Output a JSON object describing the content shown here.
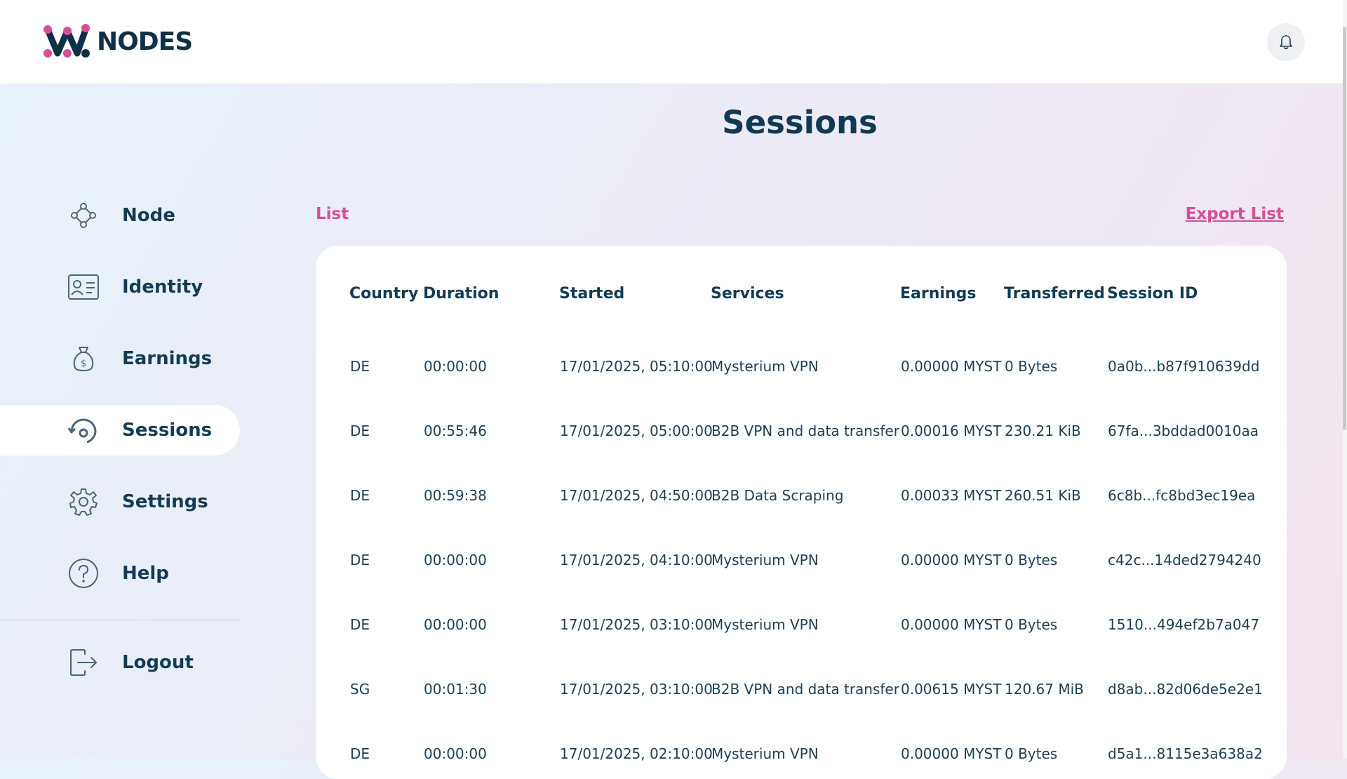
{
  "brand": {
    "name": "NODES"
  },
  "header": {
    "notification_icon": "bell-icon"
  },
  "page": {
    "title": "Sessions"
  },
  "sidebar": {
    "items": [
      {
        "label": "Node",
        "icon": "node-icon",
        "active": false
      },
      {
        "label": "Identity",
        "icon": "id-card-icon",
        "active": false
      },
      {
        "label": "Earnings",
        "icon": "money-bag-icon",
        "active": false
      },
      {
        "label": "Sessions",
        "icon": "sessions-icon",
        "active": true
      },
      {
        "label": "Settings",
        "icon": "gear-icon",
        "active": false
      },
      {
        "label": "Help",
        "icon": "help-icon",
        "active": false
      }
    ],
    "logout": {
      "label": "Logout",
      "icon": "logout-icon"
    }
  },
  "toolbar": {
    "list_label": "List",
    "export_label": "Export List"
  },
  "table": {
    "columns": [
      "Country",
      "Duration",
      "Started",
      "Services",
      "Earnings",
      "Transferred",
      "Session ID"
    ],
    "rows": [
      [
        "DE",
        "00:00:00",
        "17/01/2025, 05:10:00",
        "Mysterium VPN",
        "0.00000 MYST",
        "0 Bytes",
        "0a0b...b87f910639dd"
      ],
      [
        "DE",
        "00:55:46",
        "17/01/2025, 05:00:00",
        "B2B VPN and data transfer",
        "0.00016 MYST",
        "230.21 KiB",
        "67fa...3bddad0010aa"
      ],
      [
        "DE",
        "00:59:38",
        "17/01/2025, 04:50:00",
        "B2B Data Scraping",
        "0.00033 MYST",
        "260.51 KiB",
        "6c8b...fc8bd3ec19ea"
      ],
      [
        "DE",
        "00:00:00",
        "17/01/2025, 04:10:00",
        "Mysterium VPN",
        "0.00000 MYST",
        "0 Bytes",
        "c42c...14ded2794240"
      ],
      [
        "DE",
        "00:00:00",
        "17/01/2025, 03:10:00",
        "Mysterium VPN",
        "0.00000 MYST",
        "0 Bytes",
        "1510...494ef2b7a047"
      ],
      [
        "SG",
        "00:01:30",
        "17/01/2025, 03:10:00",
        "B2B VPN and data transfer",
        "0.00615 MYST",
        "120.67 MiB",
        "d8ab...82d06de5e2e1"
      ],
      [
        "DE",
        "00:00:00",
        "17/01/2025, 02:10:00",
        "Mysterium VPN",
        "0.00000 MYST",
        "0 Bytes",
        "d5a1...8115e3a638a2"
      ]
    ]
  },
  "colors": {
    "accent": "#d64f96",
    "text": "#123c56",
    "logo_pink": "#d64f96",
    "logo_dark": "#0f3047"
  }
}
